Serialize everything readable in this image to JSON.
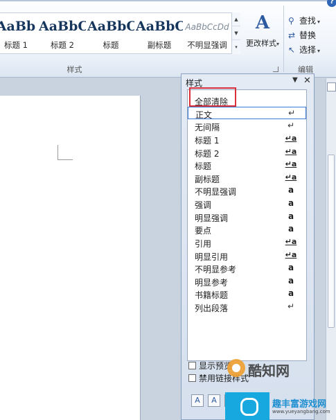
{
  "ribbon": {
    "style_gallery": [
      {
        "preview": "AaBb",
        "name": "标题 1"
      },
      {
        "preview": "AaBbC",
        "name": "标题 2"
      },
      {
        "preview": "AaBbC",
        "name": "标题"
      },
      {
        "preview": "AaBbC",
        "name": "副标题"
      },
      {
        "preview": "AaBbCcDd",
        "name": "不明显强调"
      }
    ],
    "change_styles_label": "更改样式",
    "group_label": "样式",
    "edit_group": {
      "find_label": "查找",
      "replace_label": "替换",
      "select_label": "选择",
      "group_label": "编辑"
    }
  },
  "styles_pane": {
    "title": "样式",
    "items": [
      {
        "name": "全部清除",
        "icon": ""
      },
      {
        "name": "正文",
        "icon": "↵"
      },
      {
        "name": "无间隔",
        "icon": "↵"
      },
      {
        "name": "标题 1",
        "icon": "↵a"
      },
      {
        "name": "标题 2",
        "icon": "↵a"
      },
      {
        "name": "标题",
        "icon": "↵a"
      },
      {
        "name": "副标题",
        "icon": "↵a"
      },
      {
        "name": "不明显强调",
        "icon": "a"
      },
      {
        "name": "强调",
        "icon": "a"
      },
      {
        "name": "明显强调",
        "icon": "a"
      },
      {
        "name": "要点",
        "icon": "a"
      },
      {
        "name": "引用",
        "icon": "↵a"
      },
      {
        "name": "明显引用",
        "icon": "↵a"
      },
      {
        "name": "不明显参考",
        "icon": "a"
      },
      {
        "name": "明显参考",
        "icon": "a"
      },
      {
        "name": "书籍标题",
        "icon": "a"
      },
      {
        "name": "列出段落",
        "icon": "↵"
      }
    ],
    "show_preview_label": "显示预览",
    "disable_linked_label": "禁用链接样式",
    "highlight_color": "#d9303c"
  },
  "watermarks": {
    "center_text": "酷知网",
    "corner_title": "趣丰富游戏网",
    "corner_url": "www.yueyangbang.com"
  }
}
